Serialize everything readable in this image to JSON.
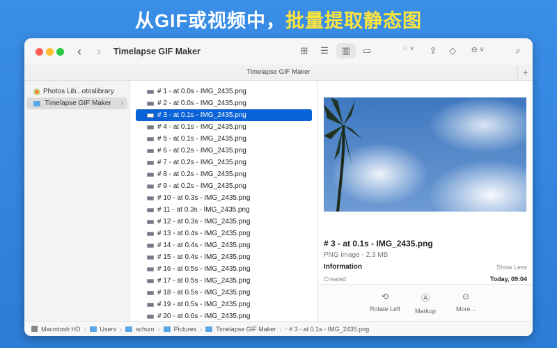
{
  "headline": {
    "part1": "从GIF或视频中，",
    "part2": "批量提取静态图"
  },
  "window": {
    "title": "Timelapse GIF Maker",
    "tab": "Timelapse GIF Maker"
  },
  "sidebar": {
    "items": [
      {
        "label": "Photos Lib...otoslibrary"
      },
      {
        "label": "Timelapse GIF Maker"
      }
    ]
  },
  "files": [
    "# 1 - at 0.0s - IMG_2435.png",
    "# 2 - at 0.0s - IMG_2435.png",
    "# 3 - at 0.1s - IMG_2435.png",
    "# 4 - at 0.1s - IMG_2435.png",
    "# 5 - at 0.1s - IMG_2435.png",
    "# 6 - at 0.2s - IMG_2435.png",
    "# 7 - at 0.2s - IMG_2435.png",
    "# 8 - at 0.2s - IMG_2435.png",
    "# 9 - at 0.2s - IMG_2435.png",
    "# 10 - at 0.3s - IMG_2435.png",
    "# 11 - at 0.3s - IMG_2435.png",
    "# 12 - at 0.3s - IMG_2435.png",
    "# 13 - at 0.4s - IMG_2435.png",
    "# 14 - at 0.4s - IMG_2435.png",
    "# 15 - at 0.4s - IMG_2435.png",
    "# 16 - at 0.5s - IMG_2435.png",
    "# 17 - at 0.5s - IMG_2435.png",
    "# 18 - at 0.5s - IMG_2435.png",
    "# 19 - at 0.5s - IMG_2435.png",
    "# 20 - at 0.6s - IMG_2435.png"
  ],
  "selected_index": 2,
  "preview": {
    "name": "# 3 - at 0.1s - IMG_2435.png",
    "type": "PNG image - 2.3 MB",
    "info_label": "Information",
    "show_less": "Show Less",
    "created_label": "Created",
    "created_value": "Today, 09:04"
  },
  "actions": [
    {
      "label": "Rotate Left",
      "icon": "rotate-left-icon"
    },
    {
      "label": "Markup",
      "icon": "markup-icon"
    },
    {
      "label": "More...",
      "icon": "more-icon"
    }
  ],
  "pathbar": [
    "Macintosh HD",
    "Users",
    "schum",
    "Pictures",
    "Timelapse GIF Maker",
    "# 3 - at 0.1s - IMG_2435.png"
  ]
}
